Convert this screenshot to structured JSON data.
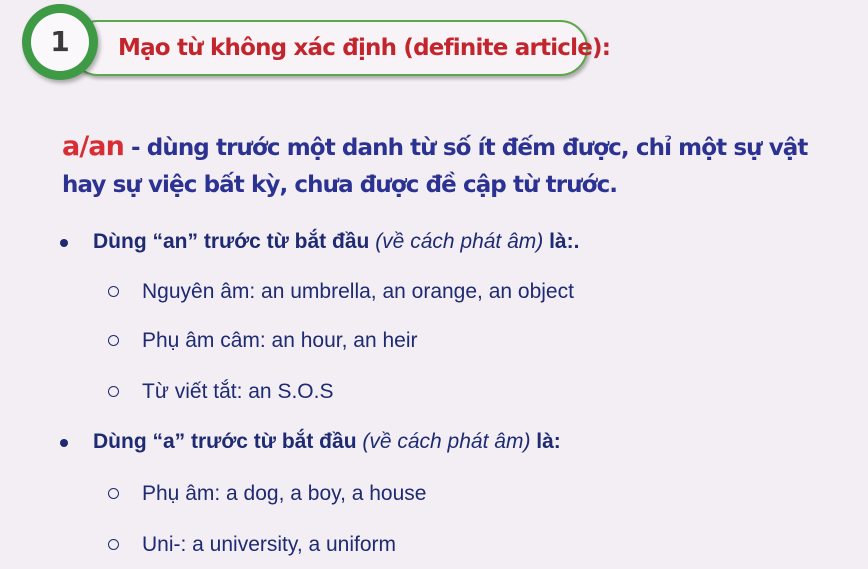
{
  "header": {
    "number": "1",
    "title": "Mạo từ không xác định (definite article):"
  },
  "definition": {
    "term": "a/an",
    "text": " - dùng trước một danh từ số ít đếm được, chỉ một sự vật hay sự việc bất kỳ, chưa được đề cập từ trước."
  },
  "bullets": [
    {
      "lead": "Dùng “an” trước từ bắt đầu ",
      "note": "(về cách phát âm)",
      "tail": " là:.",
      "subitems": [
        "Nguyên âm: an umbrella, an orange, an object",
        "Phụ âm câm: an hour, an heir",
        "Từ viết tắt: an S.O.S"
      ]
    },
    {
      "lead": "Dùng “a” trước từ bắt đầu ",
      "note": "(về cách phát âm)",
      "tail": " là:",
      "subitems": [
        "Phụ âm: a dog, a boy, a house",
        "Uni-: a university, a uniform"
      ]
    }
  ],
  "colors": {
    "accent_green": "#3e9a45",
    "title_red": "#c3252d",
    "text_navy": "#2b3291"
  }
}
